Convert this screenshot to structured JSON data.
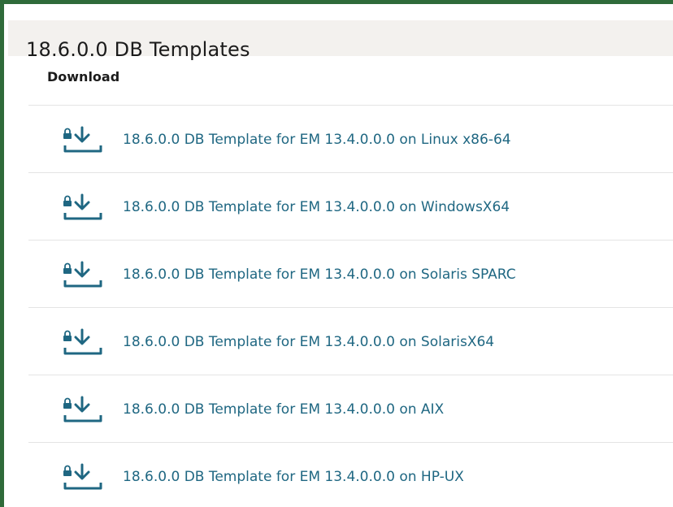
{
  "page": {
    "title": "18.6.0.0 DB Templates",
    "section_label": "Download"
  },
  "colors": {
    "link": "#1f6782",
    "icon": "#1f6782",
    "frame_border": "#2f6b3a",
    "title_bar_bg": "#f3f1ee",
    "divider": "#e4e4e4"
  },
  "downloads": [
    {
      "label": "18.6.0.0 DB Template for EM 13.4.0.0.0 on Linux x86-64",
      "icon": "locked-download-icon"
    },
    {
      "label": "18.6.0.0 DB Template for EM 13.4.0.0.0 on WindowsX64",
      "icon": "locked-download-icon"
    },
    {
      "label": "18.6.0.0 DB Template for EM 13.4.0.0.0 on Solaris SPARC",
      "icon": "locked-download-icon"
    },
    {
      "label": "18.6.0.0 DB Template for EM 13.4.0.0.0 on SolarisX64",
      "icon": "locked-download-icon"
    },
    {
      "label": "18.6.0.0 DB Template for EM 13.4.0.0.0 on AIX",
      "icon": "locked-download-icon"
    },
    {
      "label": "18.6.0.0 DB Template for EM 13.4.0.0.0 on HP-UX",
      "icon": "locked-download-icon"
    }
  ]
}
